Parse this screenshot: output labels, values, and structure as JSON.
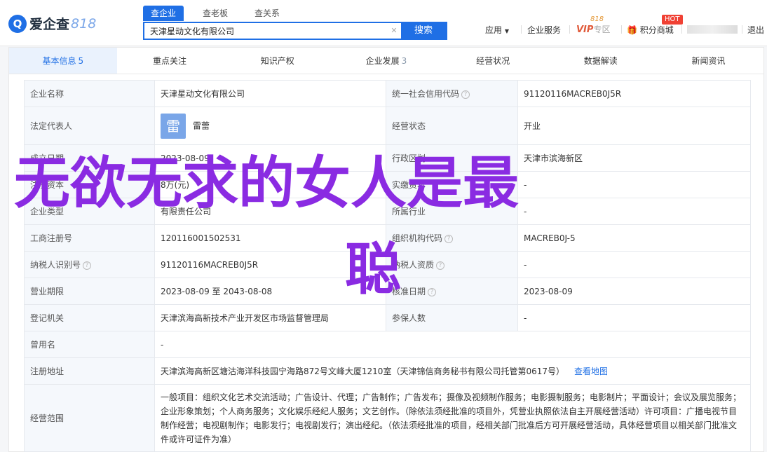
{
  "header": {
    "logo_text": "爱企查",
    "logo_num": "818",
    "search_tabs": [
      "查企业",
      "查老板",
      "查关系"
    ],
    "search_value": "天津星动文化有限公司",
    "search_button": "搜索",
    "nav": {
      "app": "应用",
      "enterprise_service": "企业服务",
      "vip": "VIP",
      "vip_sub": "专区",
      "vip_badge": "818",
      "mall": "积分商城",
      "hot": "HOT",
      "logout": "退出"
    }
  },
  "tabs": [
    {
      "label": "基本信息",
      "count": "5"
    },
    {
      "label": "重点关注",
      "count": ""
    },
    {
      "label": "知识产权",
      "count": ""
    },
    {
      "label": "企业发展",
      "count": "3"
    },
    {
      "label": "经营状况",
      "count": ""
    },
    {
      "label": "数据解读",
      "count": ""
    },
    {
      "label": "新闻资讯",
      "count": ""
    }
  ],
  "info": {
    "name_k": "企业名称",
    "name_v": "天津星动文化有限公司",
    "credit_k": "统一社会信用代码",
    "credit_v": "91120116MACREB0J5R",
    "legal_k": "法定代表人",
    "legal_avatar": "雷",
    "legal_v": "雷蕾",
    "status_k": "经营状态",
    "status_v": "开业",
    "date_k": "成立日期",
    "date_v": "2023-08-09",
    "region_k": "行政区划",
    "region_v": "天津市滨海新区",
    "capital_k": "注册资本",
    "capital_v": "8万(元)",
    "paid_k": "实缴资本",
    "paid_v": "-",
    "type_k": "企业类型",
    "type_v": "有限责任公司",
    "industry_k": "所属行业",
    "industry_v": "-",
    "reg_k": "工商注册号",
    "reg_v": "120116001502531",
    "org_k": "组织机构代码",
    "org_v": "MACREB0J-5",
    "tax_k": "纳税人识别号",
    "tax_v": "91120116MACREB0J5R",
    "qual_k": "纳税人资质",
    "qual_v": "-",
    "term_k": "营业期限",
    "term_v": "2023-08-09 至 2043-08-08",
    "approve_k": "核准日期",
    "approve_v": "2023-08-09",
    "authority_k": "登记机关",
    "authority_v": "天津滨海高新技术产业开发区市场监督管理局",
    "insured_k": "参保人数",
    "insured_v": "-",
    "former_k": "曾用名",
    "former_v": "-",
    "addr_k": "注册地址",
    "addr_v": "天津滨海高新区塘沽海洋科技园宁海路872号文峰大厦1210室（天津锦信商务秘书有限公司托管第0617号）",
    "map_link": "查看地图",
    "scope_k": "经营范围",
    "scope_v": "一般项目：组织文化艺术交流活动；广告设计、代理；广告制作；广告发布；摄像及视频制作服务；电影摄制服务；电影制片；平面设计；会议及展览服务；企业形象策划；个人商务服务；文化娱乐经纪人服务；文艺创作。（除依法须经批准的项目外，凭营业执照依法自主开展经营活动）许可项目：广播电视节目制作经营；电视剧制作；电影发行；电视剧发行；演出经纪。（依法须经批准的项目，经相关部门批准后方可开展经营活动，具体经营项目以相关部门批准文件或许可证件为准）"
  },
  "overlay": {
    "line1": "无欲无求的女人是最",
    "line2": "聪"
  },
  "colors": {
    "brand": "#1f6fe5",
    "overlay": "#8a2be2"
  }
}
